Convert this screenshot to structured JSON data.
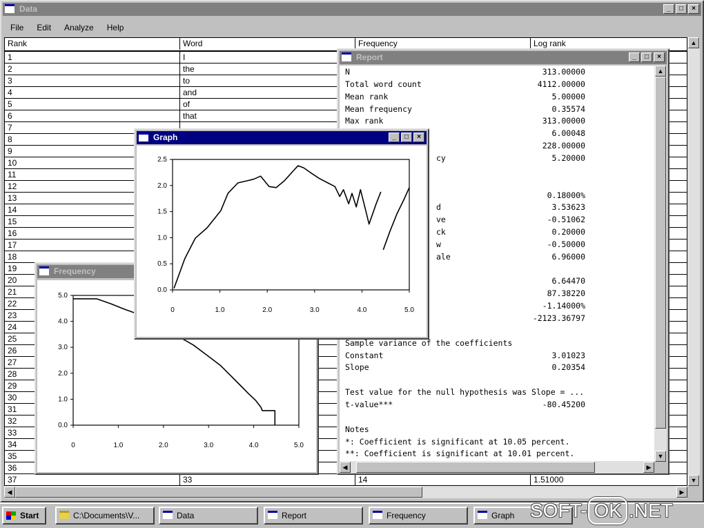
{
  "colors": {
    "desktop": "#008080",
    "active_title": "#000080",
    "inactive_title": "#808080",
    "face": "#c0c0c0"
  },
  "main_window": {
    "title": "Data",
    "menu": [
      "File",
      "Edit",
      "Analyze",
      "Help"
    ]
  },
  "grid": {
    "headers": [
      "Rank",
      "Word",
      "Frequency",
      "Log rank"
    ],
    "rows": [
      [
        "1",
        "I",
        "",
        ""
      ],
      [
        "2",
        "the",
        "",
        ""
      ],
      [
        "3",
        "to",
        "",
        ""
      ],
      [
        "4",
        "and",
        "",
        ""
      ],
      [
        "5",
        "of",
        "",
        ""
      ],
      [
        "6",
        "that",
        "",
        ""
      ],
      [
        "7",
        "",
        "",
        ""
      ],
      [
        "8",
        "",
        "",
        ""
      ],
      [
        "9",
        "",
        "",
        ""
      ],
      [
        "10",
        "",
        "",
        ""
      ],
      [
        "11",
        "",
        "",
        ""
      ],
      [
        "12",
        "",
        "",
        ""
      ],
      [
        "13",
        "",
        "",
        ""
      ],
      [
        "14",
        "",
        "",
        ""
      ],
      [
        "15",
        "",
        "",
        ""
      ],
      [
        "16",
        "",
        "",
        ""
      ],
      [
        "17",
        "",
        "",
        ""
      ],
      [
        "18",
        "",
        "",
        ""
      ],
      [
        "19",
        "",
        "",
        ""
      ],
      [
        "20",
        "",
        "",
        ""
      ],
      [
        "21",
        "",
        "",
        ""
      ],
      [
        "22",
        "",
        "",
        ""
      ],
      [
        "23",
        "",
        "",
        ""
      ],
      [
        "24",
        "",
        "",
        ""
      ],
      [
        "25",
        "",
        "",
        ""
      ],
      [
        "26",
        "",
        "",
        ""
      ],
      [
        "27",
        "",
        "",
        ""
      ],
      [
        "28",
        "",
        "",
        ""
      ],
      [
        "29",
        "",
        "",
        ""
      ],
      [
        "30",
        "",
        "",
        ""
      ],
      [
        "31",
        "",
        "",
        ""
      ],
      [
        "32",
        "",
        "",
        ""
      ],
      [
        "33",
        "",
        "",
        ""
      ],
      [
        "34",
        "",
        "",
        ""
      ],
      [
        "35",
        "",
        "",
        ""
      ],
      [
        "36",
        "",
        "",
        ""
      ],
      [
        "37",
        "33",
        "14",
        "1.51000"
      ]
    ]
  },
  "report": {
    "title": "Report",
    "lines": [
      {
        "label": "N",
        "value": "313.00000"
      },
      {
        "label": "Total word count",
        "value": "4112.00000"
      },
      {
        "label": "Mean rank",
        "value": "5.00000"
      },
      {
        "label": "Mean frequency",
        "value": "0.35574"
      },
      {
        "label": "Max rank",
        "value": "313.00000"
      },
      {
        "value": "6.00048"
      },
      {
        "value": "228.00000"
      },
      {
        "tail": "cy",
        "value": "5.20000"
      },
      {},
      {},
      {
        "value": "0.18000%"
      },
      {
        "tail": "d",
        "value": "3.53623"
      },
      {
        "tail": "ve",
        "value": "-0.51062"
      },
      {
        "tail": "ck",
        "value": "0.20000"
      },
      {
        "tail": "w",
        "value": "-0.50000"
      },
      {
        "tail": "ale",
        "value": "6.96000"
      },
      {},
      {
        "value": "6.64470"
      },
      {
        "value": "87.38220"
      },
      {
        "value": "-1.14000%"
      },
      {
        "value": "-2123.36797"
      },
      {},
      {
        "label": "Sample variance of the coefficients"
      },
      {
        "label": "Constant",
        "value": "3.01023"
      },
      {
        "label": "Slope",
        "value": "0.20354"
      },
      {},
      {
        "label": "Test value for the null hypothesis was Slope = ..."
      },
      {
        "label": "t-value***",
        "value": "-80.45200"
      },
      {},
      {
        "label": "Notes"
      },
      {
        "label": "*: Coefficient is significant at 10.05 percent."
      },
      {
        "label": "**: Coefficient is significant at 10.01 percent."
      }
    ]
  },
  "graph_window": {
    "title": "Graph"
  },
  "frequency_window": {
    "title": "Frequency"
  },
  "taskbar": {
    "start": "Start",
    "buttons": [
      "C:\\Documents\\V...",
      "Data",
      "Report",
      "Frequency",
      "Graph"
    ]
  },
  "watermark": {
    "part1": "SOFT-",
    "part2": "OK",
    "part3": ".NET"
  },
  "chart_data": [
    {
      "type": "line",
      "xlim": [
        0,
        5
      ],
      "ylim": [
        0,
        2.5
      ],
      "xticks": [
        "0",
        "1.0",
        "2.0",
        "3.0",
        "4.0",
        "5.0"
      ],
      "yticks": [
        "2.5",
        "2.0",
        "1.5",
        "1.0",
        "0.5",
        "0.0"
      ],
      "grid": false,
      "series": [
        {
          "points": [
            [
              0.03,
              0.03
            ],
            [
              0.26,
              0.6
            ],
            [
              0.48,
              0.99
            ],
            [
              0.73,
              1.19
            ],
            [
              1.02,
              1.52
            ],
            [
              1.17,
              1.85
            ],
            [
              1.38,
              2.05
            ],
            [
              1.57,
              2.09
            ],
            [
              1.71,
              2.12
            ],
            [
              1.86,
              2.18
            ],
            [
              2.04,
              1.98
            ],
            [
              2.19,
              1.96
            ],
            [
              2.36,
              2.09
            ],
            [
              2.55,
              2.28
            ],
            [
              2.65,
              2.38
            ],
            [
              2.77,
              2.34
            ],
            [
              2.91,
              2.25
            ],
            [
              3.09,
              2.14
            ],
            [
              3.28,
              2.05
            ],
            [
              3.43,
              1.98
            ],
            [
              3.53,
              1.79
            ],
            [
              3.61,
              1.92
            ],
            [
              3.72,
              1.65
            ],
            [
              3.79,
              1.85
            ],
            [
              3.88,
              1.59
            ],
            [
              3.97,
              1.92
            ],
            [
              4.08,
              1.52
            ],
            [
              4.15,
              1.26
            ],
            [
              4.3,
              1.65
            ],
            [
              4.4,
              1.88
            ]
          ]
        },
        {
          "points": [
            [
              4.45,
              0.77
            ],
            [
              4.59,
              1.12
            ],
            [
              4.74,
              1.46
            ],
            [
              4.88,
              1.72
            ],
            [
              5.0,
              1.96
            ]
          ]
        }
      ]
    },
    {
      "type": "line",
      "xlim": [
        0,
        5
      ],
      "ylim": [
        0,
        5
      ],
      "xticks": [
        "0",
        "1.0",
        "2.0",
        "3.0",
        "4.0",
        "5.0"
      ],
      "yticks": [
        "5.0",
        "4.0",
        "3.0",
        "2.0",
        "1.0",
        "0.0"
      ],
      "grid": false,
      "series": [
        {
          "points": [
            [
              0,
              4.87
            ],
            [
              0.52,
              4.87
            ],
            [
              0.83,
              4.68
            ],
            [
              1.13,
              4.47
            ],
            [
              1.44,
              4.28
            ],
            [
              1.9,
              3.99
            ],
            [
              2.35,
              3.4
            ],
            [
              2.66,
              3.09
            ],
            [
              2.97,
              2.69
            ],
            [
              3.27,
              2.29
            ],
            [
              3.5,
              1.89
            ],
            [
              3.73,
              1.49
            ],
            [
              3.88,
              1.22
            ],
            [
              4.04,
              0.96
            ],
            [
              4.16,
              0.69
            ],
            [
              4.19,
              0.56
            ],
            [
              4.47,
              0.56
            ],
            [
              4.47,
              0.0
            ]
          ]
        }
      ]
    }
  ]
}
